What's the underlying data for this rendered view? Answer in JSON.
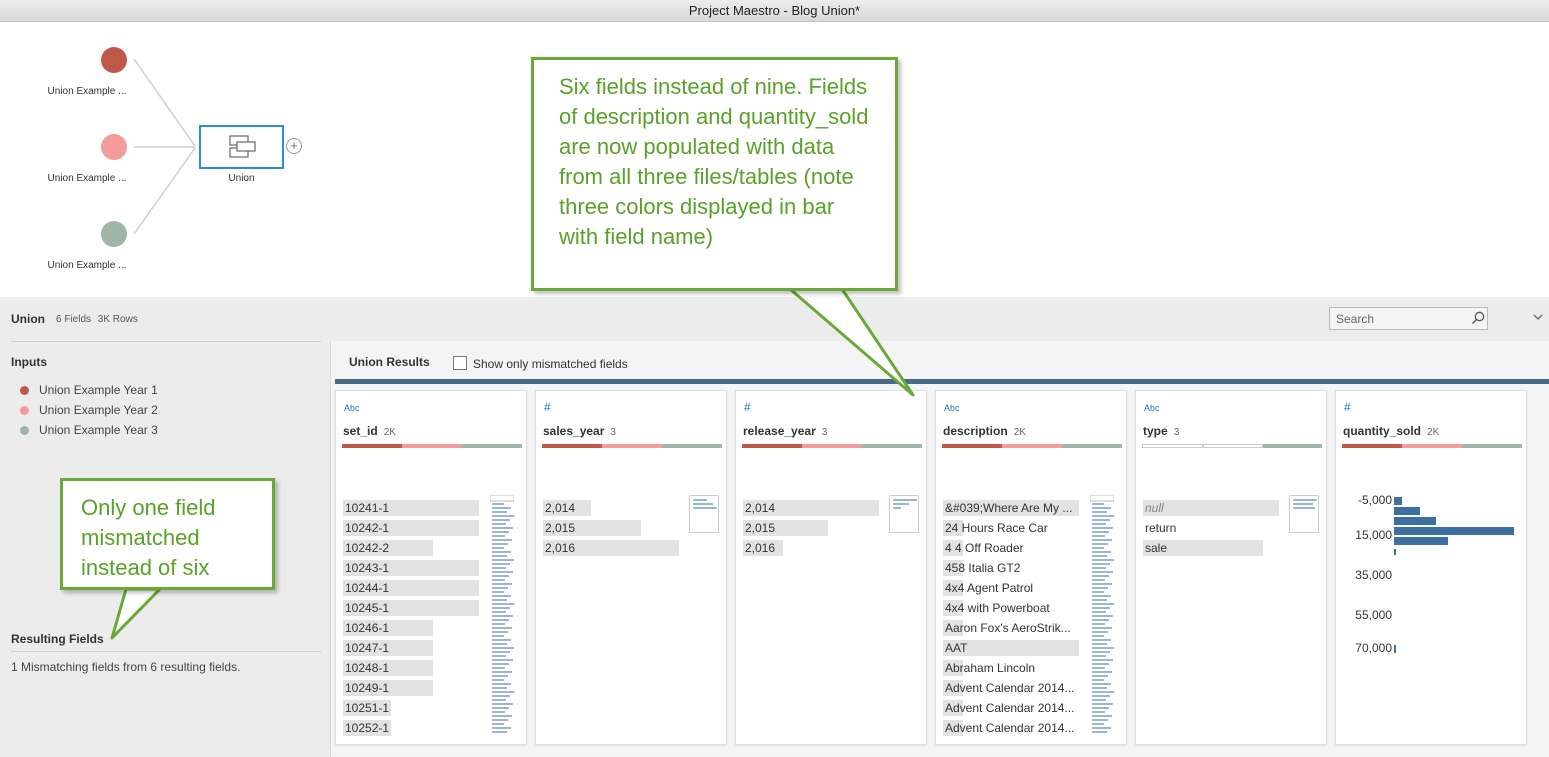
{
  "window": {
    "title": "Project Maestro - Blog Union*"
  },
  "flow": {
    "inputs": [
      {
        "label": "Union Example ...",
        "color": "#c0584a"
      },
      {
        "label": "Union Example ...",
        "color": "#f49b9b"
      },
      {
        "label": "Union Example ...",
        "color": "#9fb5a8"
      }
    ],
    "union_node": {
      "label": "Union"
    },
    "add_symbol": "+"
  },
  "panel": {
    "title": "Union",
    "fields_count": "6 Fields",
    "rows_count": "3K Rows",
    "search": {
      "placeholder": "Search"
    },
    "inputs_title": "Inputs",
    "inputs": [
      {
        "label": "Union Example Year 1",
        "color": "#c0584a"
      },
      {
        "label": "Union Example Year 2",
        "color": "#f49b9b"
      },
      {
        "label": "Union Example Year 3",
        "color": "#9fb5a8"
      }
    ],
    "resulting_fields_title": "Resulting Fields",
    "resulting_fields_text": "1 Mismatching fields from 6 resulting fields.",
    "results_title": "Union Results",
    "show_mismatched_label": "Show only mismatched fields"
  },
  "fields": [
    {
      "type": "Abc",
      "name": "set_id",
      "count": "2K",
      "bar": "three",
      "values": [
        "10241-1",
        "10242-1",
        "10242-2",
        "10243-1",
        "10244-1",
        "10245-1",
        "10246-1",
        "10247-1",
        "10248-1",
        "10249-1",
        "10251-1",
        "10252-1"
      ]
    },
    {
      "type": "#",
      "name": "sales_year",
      "count": "3",
      "bar": "three",
      "values": [
        "2,014",
        "2,015",
        "2,016"
      ]
    },
    {
      "type": "#",
      "name": "release_year",
      "count": "3",
      "bar": "three",
      "values": [
        "2,014",
        "2,015",
        "2,016"
      ]
    },
    {
      "type": "Abc",
      "name": "description",
      "count": "2K",
      "bar": "three",
      "values": [
        "&#039;Where Are My ...",
        "24 Hours Race Car",
        "4 4 Off Roader",
        "458 Italia GT2",
        "4x4 Agent Patrol",
        "4x4 with Powerboat",
        "Aaron Fox's AeroStrik...",
        "AAT",
        "Abraham Lincoln",
        "Advent Calendar 2014...",
        "Advent Calendar 2014...",
        "Advent Calendar 2014..."
      ]
    },
    {
      "type": "Abc",
      "name": "type",
      "count": "3",
      "bar": "partial",
      "values": [
        "null",
        "return",
        "sale"
      ]
    },
    {
      "type": "#",
      "name": "quantity_sold",
      "count": "2K",
      "bar": "three",
      "axis_labels": [
        "-5,000",
        "15,000",
        "35,000",
        "55,000",
        "70,000"
      ]
    }
  ],
  "colors": {
    "year1": "#c0584a",
    "year2": "#f49b9b",
    "year3": "#9fb5a8",
    "accent": "#2b8fd1",
    "callout": "#6aa839",
    "hist": "#3d6fa3"
  },
  "callouts": {
    "top": "Six fields instead of nine. Fields of description and quantity_sold are now populated with data from all three files/tables (note three colors displayed in bar with field name)",
    "left": "Only one field mismatched instead of six"
  }
}
